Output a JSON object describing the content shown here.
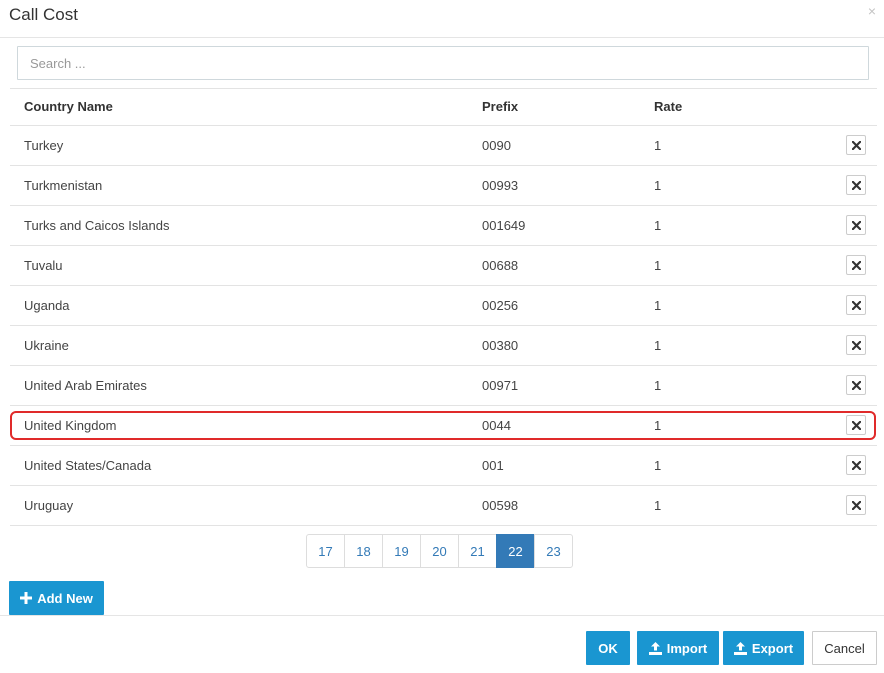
{
  "dialog": {
    "title": "Call Cost",
    "close_symbol": "×"
  },
  "search": {
    "placeholder": "Search ...",
    "value": ""
  },
  "table": {
    "headers": {
      "country": "Country Name",
      "prefix": "Prefix",
      "rate": "Rate"
    },
    "rows": [
      {
        "country": "Turkey",
        "prefix": "0090",
        "rate": "1"
      },
      {
        "country": "Turkmenistan",
        "prefix": "00993",
        "rate": "1"
      },
      {
        "country": "Turks and Caicos Islands",
        "prefix": "001649",
        "rate": "1"
      },
      {
        "country": "Tuvalu",
        "prefix": "00688",
        "rate": "1"
      },
      {
        "country": "Uganda",
        "prefix": "00256",
        "rate": "1"
      },
      {
        "country": "Ukraine",
        "prefix": "00380",
        "rate": "1"
      },
      {
        "country": "United Arab Emirates",
        "prefix": "00971",
        "rate": "1"
      },
      {
        "country": "United Kingdom",
        "prefix": "0044",
        "rate": "1"
      },
      {
        "country": "United States/Canada",
        "prefix": "001",
        "rate": "1"
      },
      {
        "country": "Uruguay",
        "prefix": "00598",
        "rate": "1"
      }
    ],
    "row_action_icon": "close-icon"
  },
  "pagination": {
    "pages": [
      "17",
      "18",
      "19",
      "20",
      "21",
      "22",
      "23"
    ],
    "active": "22"
  },
  "buttons": {
    "add_new": "Add New",
    "ok": "OK",
    "import": "Import",
    "export": "Export",
    "cancel": "Cancel"
  },
  "icons": {
    "add": "plus-icon",
    "import": "upload-icon",
    "export": "upload-icon"
  },
  "colors": {
    "primary": "#1a96d1",
    "page_active": "#337ab7",
    "highlight": "#e02a2a"
  }
}
